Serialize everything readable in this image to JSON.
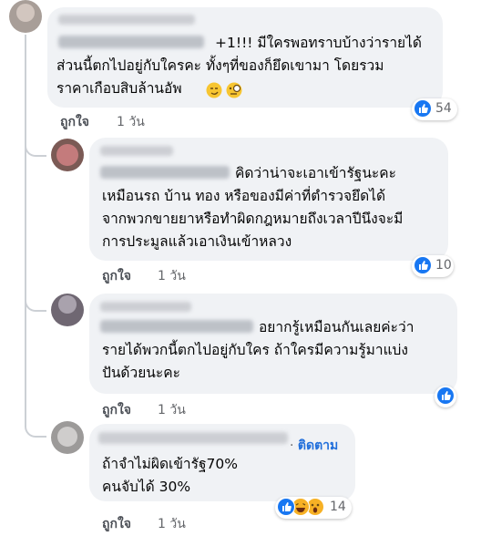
{
  "comments": [
    {
      "text": "+1!!! มีใครพอทราบบ้างว่ารายได้\nส่วนนี้ตกไปอยู่กับใครคะ ทั้งๆที่ของก็ยึดเขามา โดยรวม\nราคาเกือบสิบล้านอัพ",
      "like_label": "ถูกใจ",
      "time": "1 วัน",
      "reaction_count": "54",
      "reaction_icons": [
        "like-icon"
      ],
      "inline_emojis": [
        "smirk-emoji",
        "monocle-emoji"
      ]
    },
    {
      "text": "คิดว่าน่าจะเอาเข้ารัฐนะคะ\nเหมือนรถ บ้าน ทอง หรือของมีค่าที่ตำรวจยึดได้\nจากพวกขายยาหรือทำผิดกฎหมายถึงเวลาปีนึงจะมี\nการประมูลแล้วเอาเงินเข้าหลวง",
      "like_label": "ถูกใจ",
      "time": "1 วัน",
      "reaction_count": "10",
      "reaction_icons": [
        "like-icon"
      ]
    },
    {
      "text": "อยากรู้เหมือนกันเลยค่ะว่า\nรายได้พวกนี้ตกไปอยู่กับใคร ถ้าใครมีความรู้มาแบ่ง\nปันด้วยนะคะ",
      "like_label": "ถูกใจ",
      "time": "1 วัน",
      "reaction_count": "",
      "reaction_icons": [
        "like-icon"
      ]
    },
    {
      "follow_separator": "·",
      "follow_label": "ติดตาม",
      "text": "ถ้าจำไม่ผิดเข้ารัฐ70%\nคนจับได้ 30%",
      "like_label": "ถูกใจ",
      "time": "1 วัน",
      "reaction_count": "14",
      "reaction_icons": [
        "like-icon",
        "laugh-icon",
        "wow-icon"
      ]
    }
  ],
  "colors": {
    "bubble": "#f0f2f5",
    "like_blue": "#1877f2",
    "follow_blue": "#216fdb",
    "secondary_text": "#65676b"
  }
}
